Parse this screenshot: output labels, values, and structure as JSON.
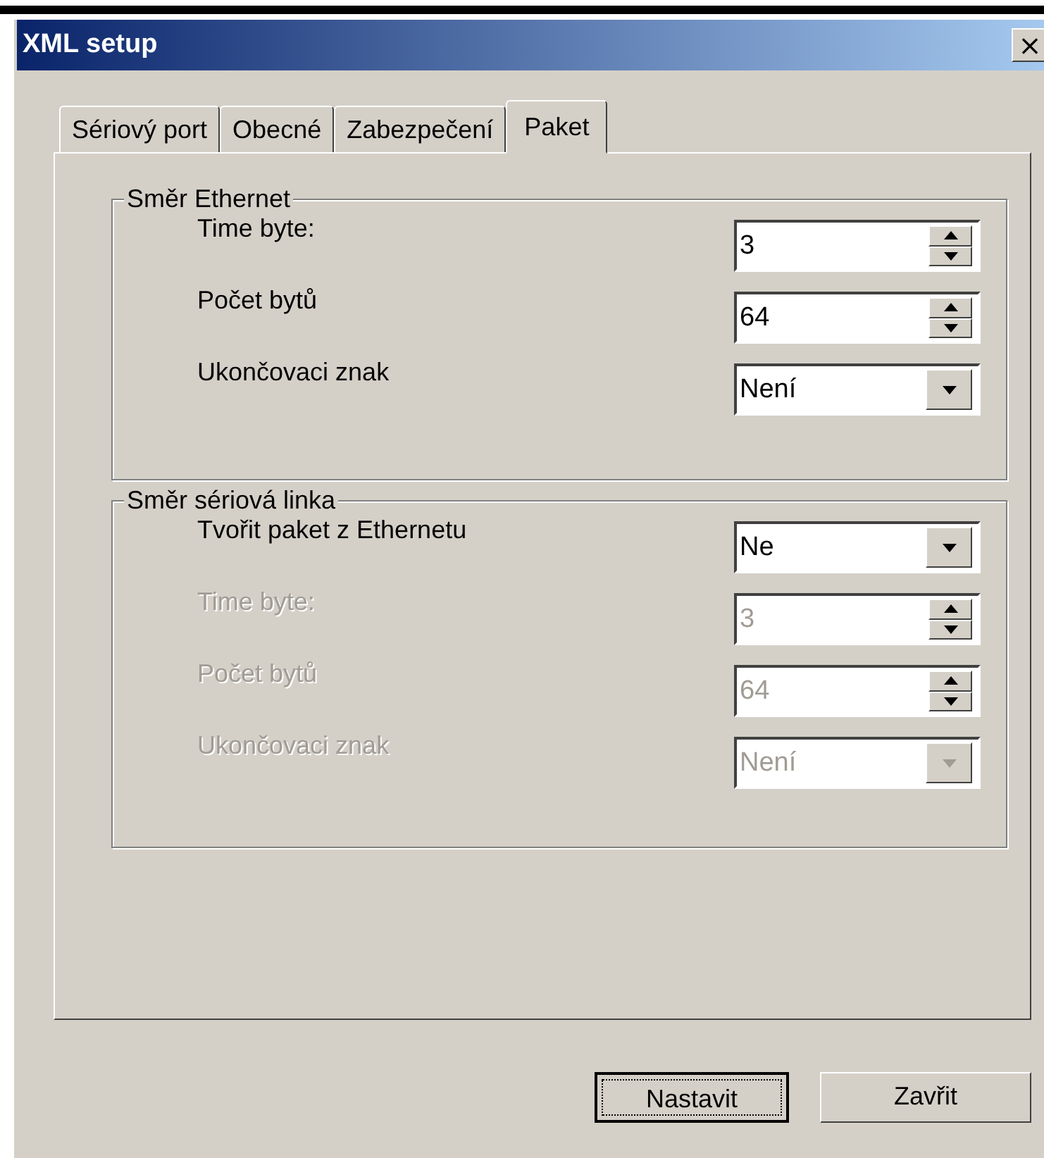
{
  "window": {
    "title": "XML setup",
    "close": "×"
  },
  "tabs": [
    {
      "label": "Sériový port",
      "selected": false
    },
    {
      "label": "Obecné",
      "selected": false
    },
    {
      "label": "Zabezpečení",
      "selected": false
    },
    {
      "label": "Paket",
      "selected": true
    }
  ],
  "groups": [
    {
      "title": "Směr Ethernet",
      "rows": [
        {
          "kind": "spin",
          "label": "Time byte:",
          "value": "3",
          "disabled": false
        },
        {
          "kind": "spin",
          "label": "Počet bytů",
          "value": "64",
          "disabled": false
        },
        {
          "kind": "combo",
          "label": "Ukončovaci znak",
          "value": "Není",
          "disabled": false
        }
      ]
    },
    {
      "title": "Směr sériová linka",
      "rows": [
        {
          "kind": "combo",
          "label": "Tvořit paket z Ethernetu",
          "value": "Ne",
          "disabled": false
        },
        {
          "kind": "spin",
          "label": "Time byte:",
          "value": "3",
          "disabled": true
        },
        {
          "kind": "spin",
          "label": "Počet bytů",
          "value": "64",
          "disabled": true
        },
        {
          "kind": "combo",
          "label": "Ukončovaci znak",
          "value": "Není",
          "disabled": true
        }
      ]
    }
  ],
  "buttons": [
    {
      "label": "Nastavit",
      "focused": true
    },
    {
      "label": "Zavřit",
      "focused": false
    }
  ]
}
